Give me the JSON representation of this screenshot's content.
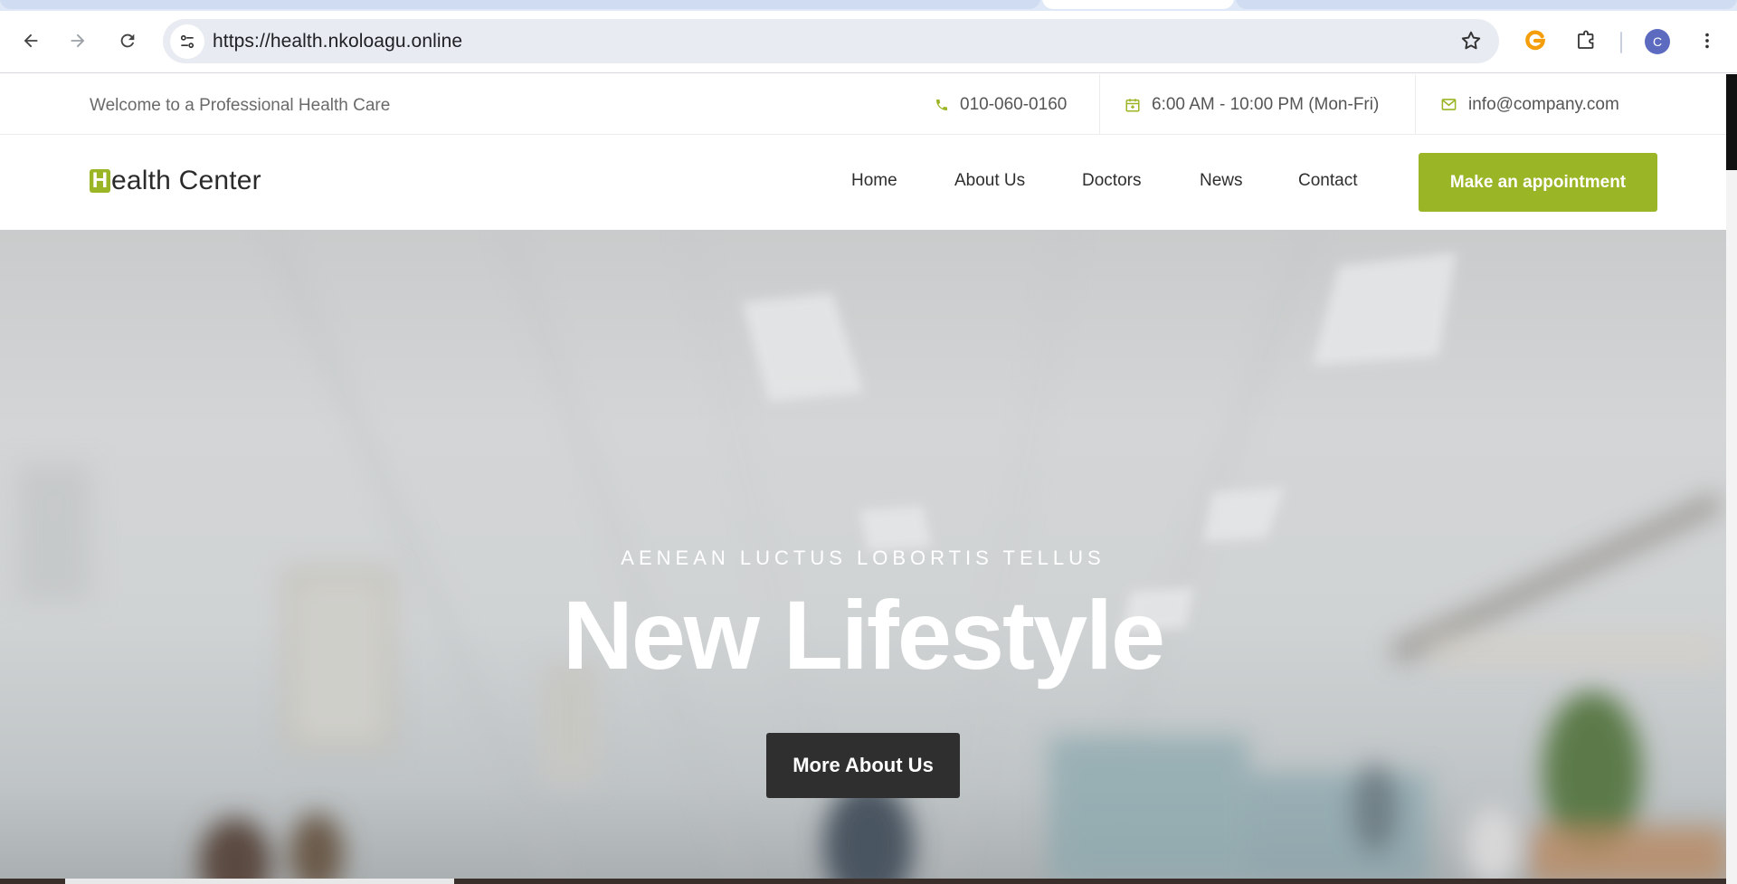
{
  "browser": {
    "url": "https://health.nkoloagu.online",
    "profile_initial": "C",
    "icons": [
      "back-arrow-icon",
      "forward-arrow-icon",
      "reload-icon",
      "site-settings-icon",
      "bookmark-star-icon",
      "extension-g-icon",
      "extensions-puzzle-icon",
      "more-menu-icon"
    ]
  },
  "topbar": {
    "welcome": "Welcome to a Professional Health Care",
    "phone": "010-060-0160",
    "hours": "6:00 AM - 10:00 PM (Mon-Fri)",
    "email": "info@company.com"
  },
  "navbar": {
    "logo_initial": "H",
    "logo_rest": "ealth Center",
    "links": [
      "Home",
      "About Us",
      "Doctors",
      "News",
      "Contact"
    ],
    "cta": "Make an appointment"
  },
  "hero": {
    "subtitle": "AENEAN LUCTUS LOBORTIS TELLUS",
    "title": "New Lifestyle",
    "button": "More About Us"
  },
  "colors": {
    "accent": "#9ab526",
    "dark_button": "#2f2f2f"
  }
}
